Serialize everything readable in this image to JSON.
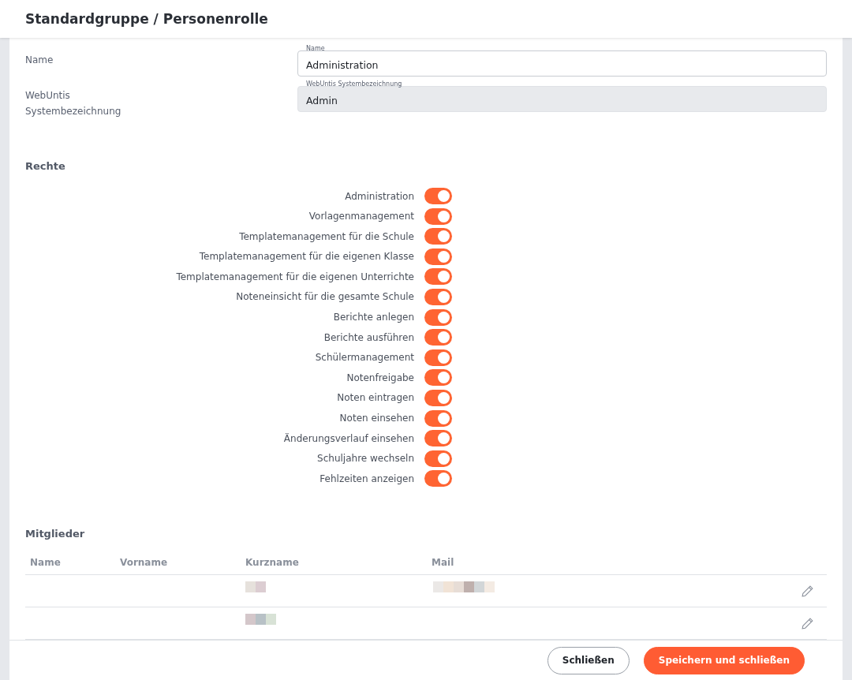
{
  "header": {
    "title": "Standardgruppe / Personenrolle"
  },
  "fields": [
    {
      "label": "Name",
      "floating_label": "Name",
      "value": "Administration",
      "disabled": false
    },
    {
      "label": "WebUntis Systembezeichnung",
      "floating_label": "WebUntis Systembezeichnung",
      "value": "Admin",
      "disabled": true
    }
  ],
  "rights": {
    "title": "Rechte",
    "items": [
      {
        "label": "Administration",
        "on": true
      },
      {
        "label": "Vorlagenmanagement",
        "on": true
      },
      {
        "label": "Templatemanagement für die Schule",
        "on": true
      },
      {
        "label": "Templatemanagement für die eigenen Klasse",
        "on": true
      },
      {
        "label": "Templatemanagement für die eigenen Unterrichte",
        "on": true
      },
      {
        "label": "Noteneinsicht für die gesamte Schule",
        "on": true
      },
      {
        "label": "Berichte anlegen",
        "on": true
      },
      {
        "label": "Berichte ausführen",
        "on": true
      },
      {
        "label": "Schülermanagement",
        "on": true
      },
      {
        "label": "Notenfreigabe",
        "on": true
      },
      {
        "label": "Noten eintragen",
        "on": true
      },
      {
        "label": "Noten einsehen",
        "on": true
      },
      {
        "label": "Änderungsverlauf einsehen",
        "on": true
      },
      {
        "label": "Schuljahre wechseln",
        "on": true
      },
      {
        "label": "Fehlzeiten anzeigen",
        "on": true
      }
    ]
  },
  "members": {
    "title": "Mitglieder",
    "columns": [
      "Name",
      "Vorname",
      "Kurzname",
      "Mail"
    ],
    "rows": [
      {
        "kurzname_redacted": true,
        "mail_redacted": true
      },
      {
        "kurzname_redacted": true,
        "mail_redacted": false
      }
    ]
  },
  "footer": {
    "buttons": [
      {
        "label": "Schließen",
        "kind": "secondary"
      },
      {
        "label": "Speichern und schließen",
        "kind": "primary"
      }
    ]
  }
}
